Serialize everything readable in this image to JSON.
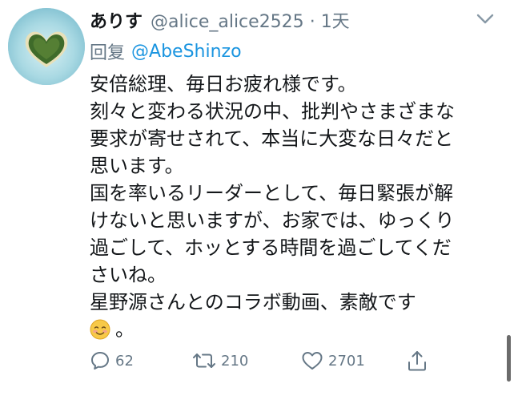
{
  "tweet": {
    "author": {
      "display_name": "ありす",
      "handle": "@alice_alice2525",
      "separator": "·",
      "time": "1天"
    },
    "reply": {
      "prefix": "回复",
      "mention": "@AbeShinzo"
    },
    "text_lines": [
      "安倍総理、毎日お疲れ様です。",
      "刻々と変わる状況の中、批判やさまざまな",
      "要求が寄せされて、本当に大変な日々だと",
      "思います。",
      "国を率いるリーダーとして、毎日緊張が解",
      "けないと思いますが、お家では、ゆっくり",
      "過ごして、ホッとする時間を過ごしてくだ",
      "さいね。",
      "星野源さんとのコラボ動画、素敵です"
    ],
    "emoji_line_tail": "。",
    "emoji": "smiling-face-icon",
    "actions": {
      "reply_count": "62",
      "retweet_count": "210",
      "like_count": "2701"
    }
  },
  "colors": {
    "text": "#14171a",
    "secondary": "#657786",
    "link": "#1b95e0"
  }
}
